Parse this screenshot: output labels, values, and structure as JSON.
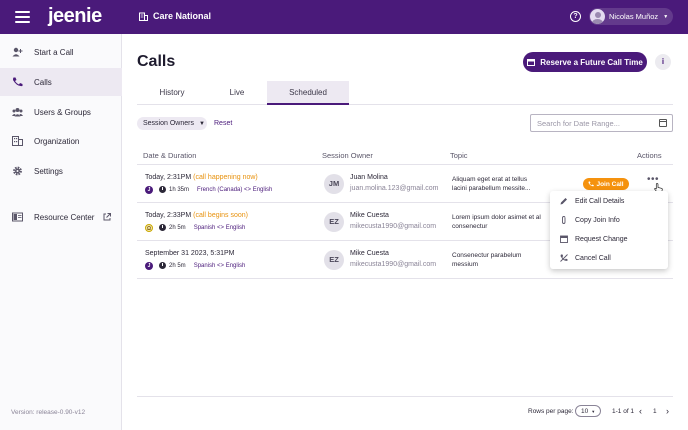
{
  "header": {
    "logo": "jeenie",
    "org_name": "Care National",
    "help_glyph": "?",
    "user_name": "Nicolas Muñoz",
    "user_caret": "▼"
  },
  "sidebar": {
    "items": [
      {
        "label": "Start a Call",
        "icon": "phone-add-icon"
      },
      {
        "label": "Calls",
        "icon": "phone-icon",
        "active": true
      },
      {
        "label": "Users & Groups",
        "icon": "users-icon"
      },
      {
        "label": "Organization",
        "icon": "building-icon"
      },
      {
        "label": "Settings",
        "icon": "gear-icon"
      },
      {
        "label": "Resource Center",
        "icon": "book-icon"
      }
    ],
    "version": "Version: release-0.90-v12"
  },
  "page": {
    "title": "Calls",
    "reserve_button": "Reserve a Future Call Time",
    "info_glyph": "i"
  },
  "tabs": [
    {
      "label": "History"
    },
    {
      "label": "Live"
    },
    {
      "label": "Scheduled",
      "active": true
    }
  ],
  "filters": {
    "session_owners": "Session Owners",
    "owners_caret": "▼",
    "reset": "Reset",
    "date_placeholder": "Search for Date Range..."
  },
  "table": {
    "headers": [
      "Date & Duration",
      "Session Owner",
      "Topic",
      "Actions"
    ],
    "rows": [
      {
        "datetime": "Today, 2:31PM",
        "status": "(call happening now)",
        "provider_glyph": "J",
        "duration": "1h 35m",
        "languages": "French (Canada) <> English",
        "initials": "JM",
        "owner_name": "Juan Molina",
        "owner_email": "juan.molina.123@gmail.com",
        "topic": "Aliquam eget erat at tellus lacini parabellum messite...",
        "join_label": "Join Call",
        "more": "•••"
      },
      {
        "datetime": "Today, 2:33PM",
        "status": "(call begins soon)",
        "provider_glyph": "Ω",
        "duration": "2h 5m",
        "languages": "Spanish <> English",
        "initials": "EZ",
        "owner_name": "Mike Cuesta",
        "owner_email": "mikecusta1990@gmail.com",
        "topic": "Lorem ipsum dolor asimet et al consenectur"
      },
      {
        "datetime": "September 31 2023, 5:31PM",
        "status": "",
        "provider_glyph": "J",
        "duration": "2h 5m",
        "languages": "Spanish <> English",
        "initials": "EZ",
        "owner_name": "Mike Cuesta",
        "owner_email": "mikecusta1990@gmail.com",
        "topic": "Consenectur parabelum messium"
      }
    ]
  },
  "actions_menu": {
    "items": [
      {
        "label": "Edit Call Details",
        "icon": "pencil-icon"
      },
      {
        "label": "Copy Join Info",
        "icon": "paperclip-icon"
      },
      {
        "label": "Request Change",
        "icon": "calendar-icon"
      },
      {
        "label": "Cancel Call",
        "icon": "phone-cancel-icon"
      }
    ]
  },
  "pagination": {
    "rows_per_page_label": "Rows per page:",
    "rows_per_page": "10",
    "rpp_caret": "▼",
    "range": "1-1 of 1",
    "prev": "‹",
    "page": "1",
    "next": "›"
  },
  "colors": {
    "brand": "#4a1a7a",
    "accent": "#f5920e",
    "status": "#e8920e"
  }
}
